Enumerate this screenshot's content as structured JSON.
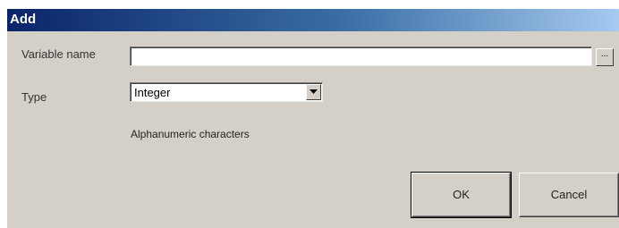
{
  "dialog": {
    "title": "Add"
  },
  "form": {
    "variable_name_label": "Variable name",
    "variable_name_value": "",
    "browse_label": "...",
    "type_label": "Type",
    "type_selected": "Integer",
    "hint_text": "Alphanumeric characters"
  },
  "buttons": {
    "ok_label": "OK",
    "cancel_label": "Cancel"
  },
  "colors": {
    "title_start": "#0a246a",
    "title_end": "#a6caf0",
    "face": "#d4d0c8"
  },
  "icons": {
    "dropdown": "chevron-down-icon"
  }
}
